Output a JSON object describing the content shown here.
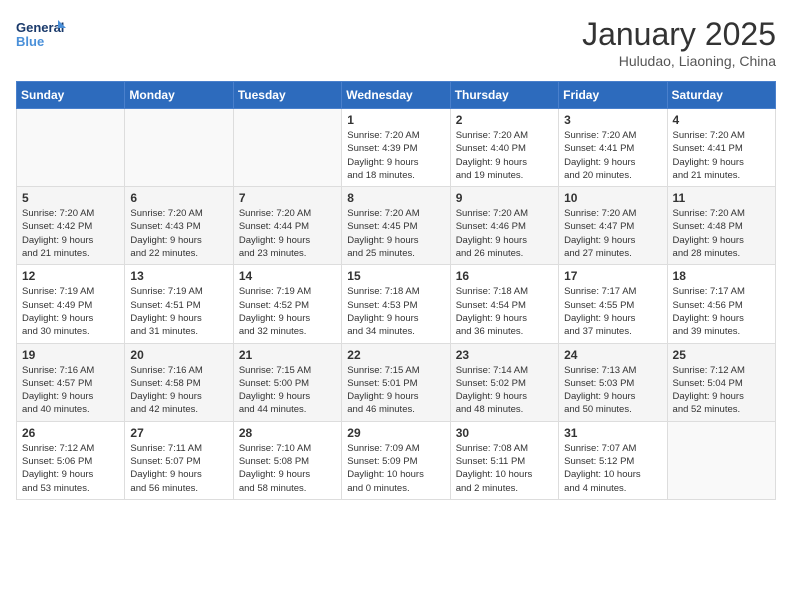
{
  "header": {
    "logo_line1": "General",
    "logo_line2": "Blue",
    "month": "January 2025",
    "location": "Huludao, Liaoning, China"
  },
  "weekdays": [
    "Sunday",
    "Monday",
    "Tuesday",
    "Wednesday",
    "Thursday",
    "Friday",
    "Saturday"
  ],
  "weeks": [
    [
      {
        "day": "",
        "info": ""
      },
      {
        "day": "",
        "info": ""
      },
      {
        "day": "",
        "info": ""
      },
      {
        "day": "1",
        "info": "Sunrise: 7:20 AM\nSunset: 4:39 PM\nDaylight: 9 hours\nand 18 minutes."
      },
      {
        "day": "2",
        "info": "Sunrise: 7:20 AM\nSunset: 4:40 PM\nDaylight: 9 hours\nand 19 minutes."
      },
      {
        "day": "3",
        "info": "Sunrise: 7:20 AM\nSunset: 4:41 PM\nDaylight: 9 hours\nand 20 minutes."
      },
      {
        "day": "4",
        "info": "Sunrise: 7:20 AM\nSunset: 4:41 PM\nDaylight: 9 hours\nand 21 minutes."
      }
    ],
    [
      {
        "day": "5",
        "info": "Sunrise: 7:20 AM\nSunset: 4:42 PM\nDaylight: 9 hours\nand 21 minutes."
      },
      {
        "day": "6",
        "info": "Sunrise: 7:20 AM\nSunset: 4:43 PM\nDaylight: 9 hours\nand 22 minutes."
      },
      {
        "day": "7",
        "info": "Sunrise: 7:20 AM\nSunset: 4:44 PM\nDaylight: 9 hours\nand 23 minutes."
      },
      {
        "day": "8",
        "info": "Sunrise: 7:20 AM\nSunset: 4:45 PM\nDaylight: 9 hours\nand 25 minutes."
      },
      {
        "day": "9",
        "info": "Sunrise: 7:20 AM\nSunset: 4:46 PM\nDaylight: 9 hours\nand 26 minutes."
      },
      {
        "day": "10",
        "info": "Sunrise: 7:20 AM\nSunset: 4:47 PM\nDaylight: 9 hours\nand 27 minutes."
      },
      {
        "day": "11",
        "info": "Sunrise: 7:20 AM\nSunset: 4:48 PM\nDaylight: 9 hours\nand 28 minutes."
      }
    ],
    [
      {
        "day": "12",
        "info": "Sunrise: 7:19 AM\nSunset: 4:49 PM\nDaylight: 9 hours\nand 30 minutes."
      },
      {
        "day": "13",
        "info": "Sunrise: 7:19 AM\nSunset: 4:51 PM\nDaylight: 9 hours\nand 31 minutes."
      },
      {
        "day": "14",
        "info": "Sunrise: 7:19 AM\nSunset: 4:52 PM\nDaylight: 9 hours\nand 32 minutes."
      },
      {
        "day": "15",
        "info": "Sunrise: 7:18 AM\nSunset: 4:53 PM\nDaylight: 9 hours\nand 34 minutes."
      },
      {
        "day": "16",
        "info": "Sunrise: 7:18 AM\nSunset: 4:54 PM\nDaylight: 9 hours\nand 36 minutes."
      },
      {
        "day": "17",
        "info": "Sunrise: 7:17 AM\nSunset: 4:55 PM\nDaylight: 9 hours\nand 37 minutes."
      },
      {
        "day": "18",
        "info": "Sunrise: 7:17 AM\nSunset: 4:56 PM\nDaylight: 9 hours\nand 39 minutes."
      }
    ],
    [
      {
        "day": "19",
        "info": "Sunrise: 7:16 AM\nSunset: 4:57 PM\nDaylight: 9 hours\nand 40 minutes."
      },
      {
        "day": "20",
        "info": "Sunrise: 7:16 AM\nSunset: 4:58 PM\nDaylight: 9 hours\nand 42 minutes."
      },
      {
        "day": "21",
        "info": "Sunrise: 7:15 AM\nSunset: 5:00 PM\nDaylight: 9 hours\nand 44 minutes."
      },
      {
        "day": "22",
        "info": "Sunrise: 7:15 AM\nSunset: 5:01 PM\nDaylight: 9 hours\nand 46 minutes."
      },
      {
        "day": "23",
        "info": "Sunrise: 7:14 AM\nSunset: 5:02 PM\nDaylight: 9 hours\nand 48 minutes."
      },
      {
        "day": "24",
        "info": "Sunrise: 7:13 AM\nSunset: 5:03 PM\nDaylight: 9 hours\nand 50 minutes."
      },
      {
        "day": "25",
        "info": "Sunrise: 7:12 AM\nSunset: 5:04 PM\nDaylight: 9 hours\nand 52 minutes."
      }
    ],
    [
      {
        "day": "26",
        "info": "Sunrise: 7:12 AM\nSunset: 5:06 PM\nDaylight: 9 hours\nand 53 minutes."
      },
      {
        "day": "27",
        "info": "Sunrise: 7:11 AM\nSunset: 5:07 PM\nDaylight: 9 hours\nand 56 minutes."
      },
      {
        "day": "28",
        "info": "Sunrise: 7:10 AM\nSunset: 5:08 PM\nDaylight: 9 hours\nand 58 minutes."
      },
      {
        "day": "29",
        "info": "Sunrise: 7:09 AM\nSunset: 5:09 PM\nDaylight: 10 hours\nand 0 minutes."
      },
      {
        "day": "30",
        "info": "Sunrise: 7:08 AM\nSunset: 5:11 PM\nDaylight: 10 hours\nand 2 minutes."
      },
      {
        "day": "31",
        "info": "Sunrise: 7:07 AM\nSunset: 5:12 PM\nDaylight: 10 hours\nand 4 minutes."
      },
      {
        "day": "",
        "info": ""
      }
    ]
  ]
}
